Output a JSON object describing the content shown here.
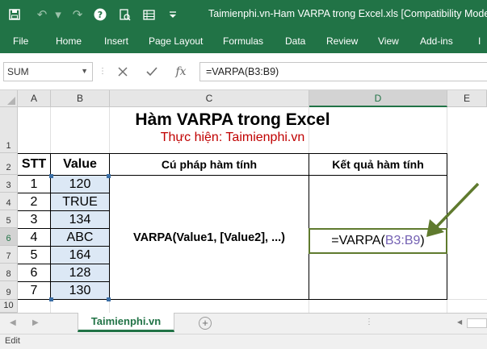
{
  "window": {
    "title": "Taimienphi.vn-Ham VARPA trong Excel.xls [Compatibility Mode]"
  },
  "ribbon": {
    "tabs": [
      "File",
      "Home",
      "Insert",
      "Page Layout",
      "Formulas",
      "Data",
      "Review",
      "View",
      "Add-ins",
      "I"
    ]
  },
  "formula_bar": {
    "name_box": "SUM",
    "cancel_icon": "close-icon",
    "enter_icon": "check-icon",
    "fx_label": "fx",
    "formula": "=VARPA(B3:B9)"
  },
  "grid": {
    "columns": [
      "A",
      "B",
      "C",
      "D",
      "E"
    ],
    "rows": [
      "1",
      "2",
      "3",
      "4",
      "5",
      "6",
      "7",
      "8",
      "9",
      "10"
    ]
  },
  "sheet": {
    "title": "Hàm VARPA trong Excel",
    "subtitle": "Thực hiện: Taimienphi.vn",
    "headers": {
      "stt": "STT",
      "value": "Value",
      "syntax": "Cú pháp hàm tính",
      "result": "Kết quả hàm tính"
    },
    "rows": [
      {
        "stt": "1",
        "value": "120"
      },
      {
        "stt": "2",
        "value": "TRUE"
      },
      {
        "stt": "3",
        "value": "134"
      },
      {
        "stt": "4",
        "value": "ABC"
      },
      {
        "stt": "5",
        "value": "164"
      },
      {
        "stt": "6",
        "value": "128"
      },
      {
        "stt": "7",
        "value": "130"
      }
    ],
    "syntax": "VARPA(Value1, [Value2], ...)",
    "result_prefix": "=VARPA(",
    "result_ref": "B3:B9",
    "result_suffix": ")"
  },
  "sheet_tabs": {
    "active": "Taimienphi.vn",
    "add_label": "+"
  },
  "status": {
    "mode": "Edit"
  },
  "colors": {
    "excel_green": "#217346",
    "subtitle_red": "#c00000",
    "range_purple": "#7461b3",
    "arrow_olive": "#5f7a2e",
    "range_fill": "#dce8f5"
  }
}
